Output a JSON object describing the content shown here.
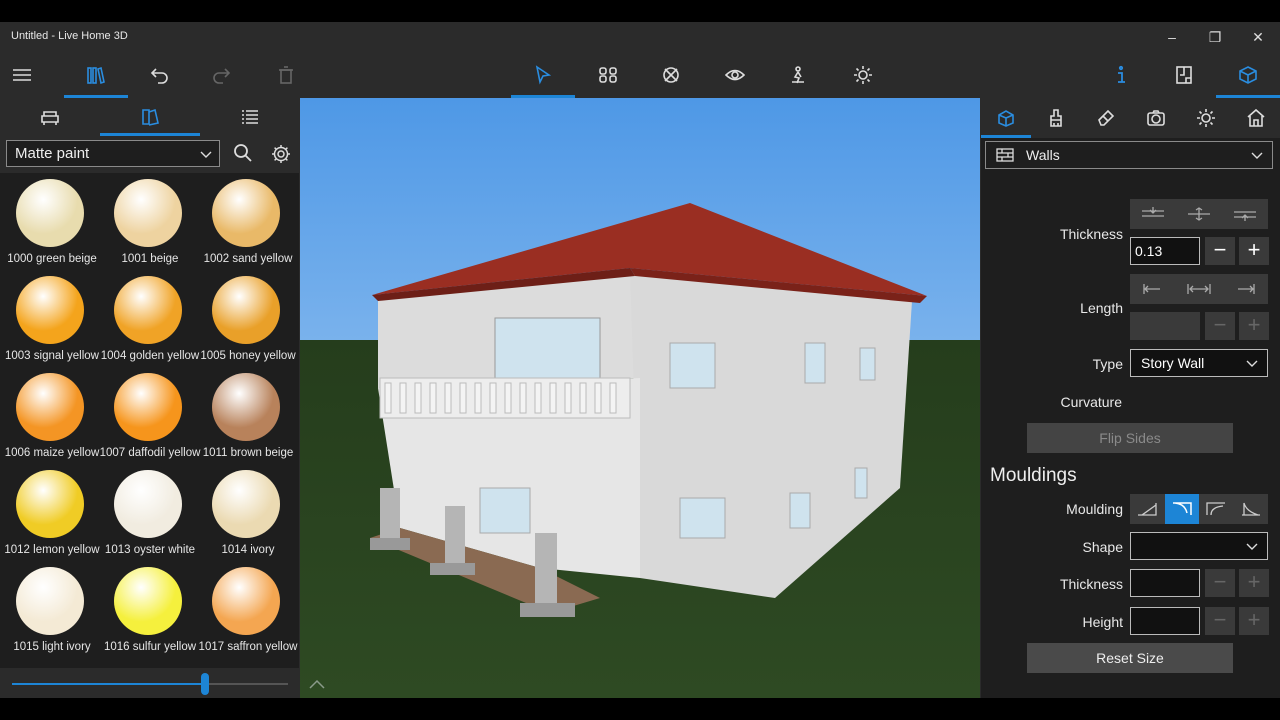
{
  "window": {
    "title": "Untitled - Live Home 3D",
    "minimize_icon": "minimize-icon",
    "maximize_icon": "restore-icon",
    "close_icon": "close-icon"
  },
  "toolbar": {
    "left_icons": [
      "menu-icon",
      "library-icon",
      "undo-icon",
      "redo-icon",
      "delete-icon"
    ],
    "center_icons": [
      "select-tool-icon",
      "walls-tool-icon",
      "unknown-tool-icon",
      "view-tool-icon",
      "walk-tool-icon",
      "lighting-tool-icon"
    ],
    "right_icons": [
      "info-icon",
      "floor-plan-icon",
      "3d-view-icon"
    ]
  },
  "library": {
    "tabs": [
      "furniture-tab",
      "materials-tab",
      "list-tab"
    ],
    "category": "Matte paint",
    "materials": [
      {
        "label": "1000 green beige",
        "color": "#e8dcae"
      },
      {
        "label": "1001 beige",
        "color": "#eed3a0"
      },
      {
        "label": "1002 sand yellow",
        "color": "#e9b968"
      },
      {
        "label": "1003 signal yellow",
        "color": "#f4a41c"
      },
      {
        "label": "1004 golden yellow",
        "color": "#f0a326"
      },
      {
        "label": "1005 honey yellow",
        "color": "#e9a029"
      },
      {
        "label": "1006 maize yellow",
        "color": "#f49524"
      },
      {
        "label": "1007 daffodil yellow",
        "color": "#f6951c"
      },
      {
        "label": "1011 brown beige",
        "color": "#b8825b"
      },
      {
        "label": "1012 lemon yellow",
        "color": "#f0cc25"
      },
      {
        "label": "1013 oyster white",
        "color": "#f1ece0"
      },
      {
        "label": "1014 ivory",
        "color": "#ebdab2"
      },
      {
        "label": "1015 light ivory",
        "color": "#f4ead5"
      },
      {
        "label": "1016 sulfur yellow",
        "color": "#f5f03d"
      },
      {
        "label": "1017 saffron yellow",
        "color": "#f4a651"
      }
    ],
    "zoom_slider_fraction": 0.7
  },
  "inspector": {
    "tabs": [
      "object-tab",
      "paint-tab",
      "edit-tab",
      "camera-tab",
      "light-tab",
      "building-tab"
    ],
    "object_type": "Walls",
    "thickness_label": "Thickness",
    "thickness_value": "0.13",
    "length_label": "Length",
    "length_value": "",
    "type_label": "Type",
    "type_value": "Story Wall",
    "curvature_label": "Curvature",
    "flip_sides": "Flip Sides",
    "mouldings_section": "Mouldings",
    "moulding_label": "Moulding",
    "shape_label": "Shape",
    "shape_value": "",
    "moulding_thickness_label": "Thickness",
    "moulding_height_label": "Height",
    "reset_size": "Reset Size",
    "minus": "−",
    "plus": "+"
  }
}
